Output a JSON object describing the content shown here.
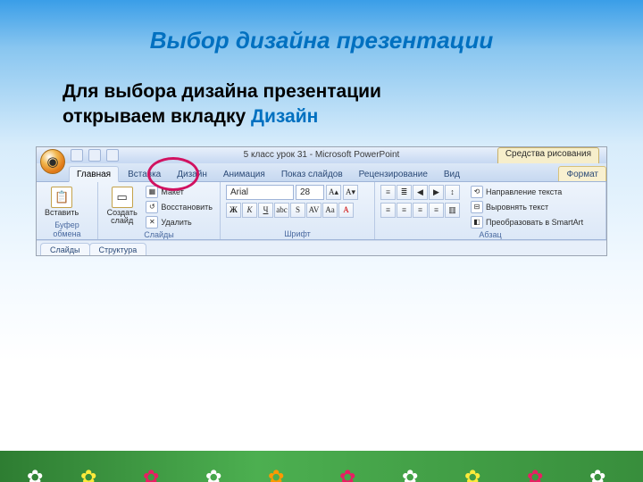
{
  "title": "Выбор дизайна презентации",
  "body": {
    "line1": "Для выбора дизайна презентации",
    "line2_a": "открываем вкладку ",
    "line2_b": "Дизайн"
  },
  "screenshot": {
    "window_title": "5 класс урок 31 - Microsoft PowerPoint",
    "context_title": "Средства рисования",
    "tabs": {
      "home": "Главная",
      "insert": "Вставка",
      "design": "Дизайн",
      "animation": "Анимация",
      "slideshow": "Показ слайдов",
      "review": "Рецензирование",
      "view": "Вид",
      "format": "Формат"
    },
    "ribbon": {
      "clipboard": {
        "label": "Буфер обмена",
        "paste": "Вставить"
      },
      "slides": {
        "label": "Слайды",
        "new_slide": "Создать\nслайд",
        "layout": "Макет",
        "reset": "Восстановить",
        "delete": "Удалить"
      },
      "font": {
        "label": "Шрифт",
        "family": "Arial",
        "size": "28"
      },
      "paragraph": {
        "label": "Абзац",
        "text_dir": "Направление текста",
        "align_text": "Выровнять текст",
        "smartart": "Преобразовать в SmartArt"
      }
    },
    "subtabs": {
      "slides": "Слайды",
      "outline": "Структура"
    }
  }
}
